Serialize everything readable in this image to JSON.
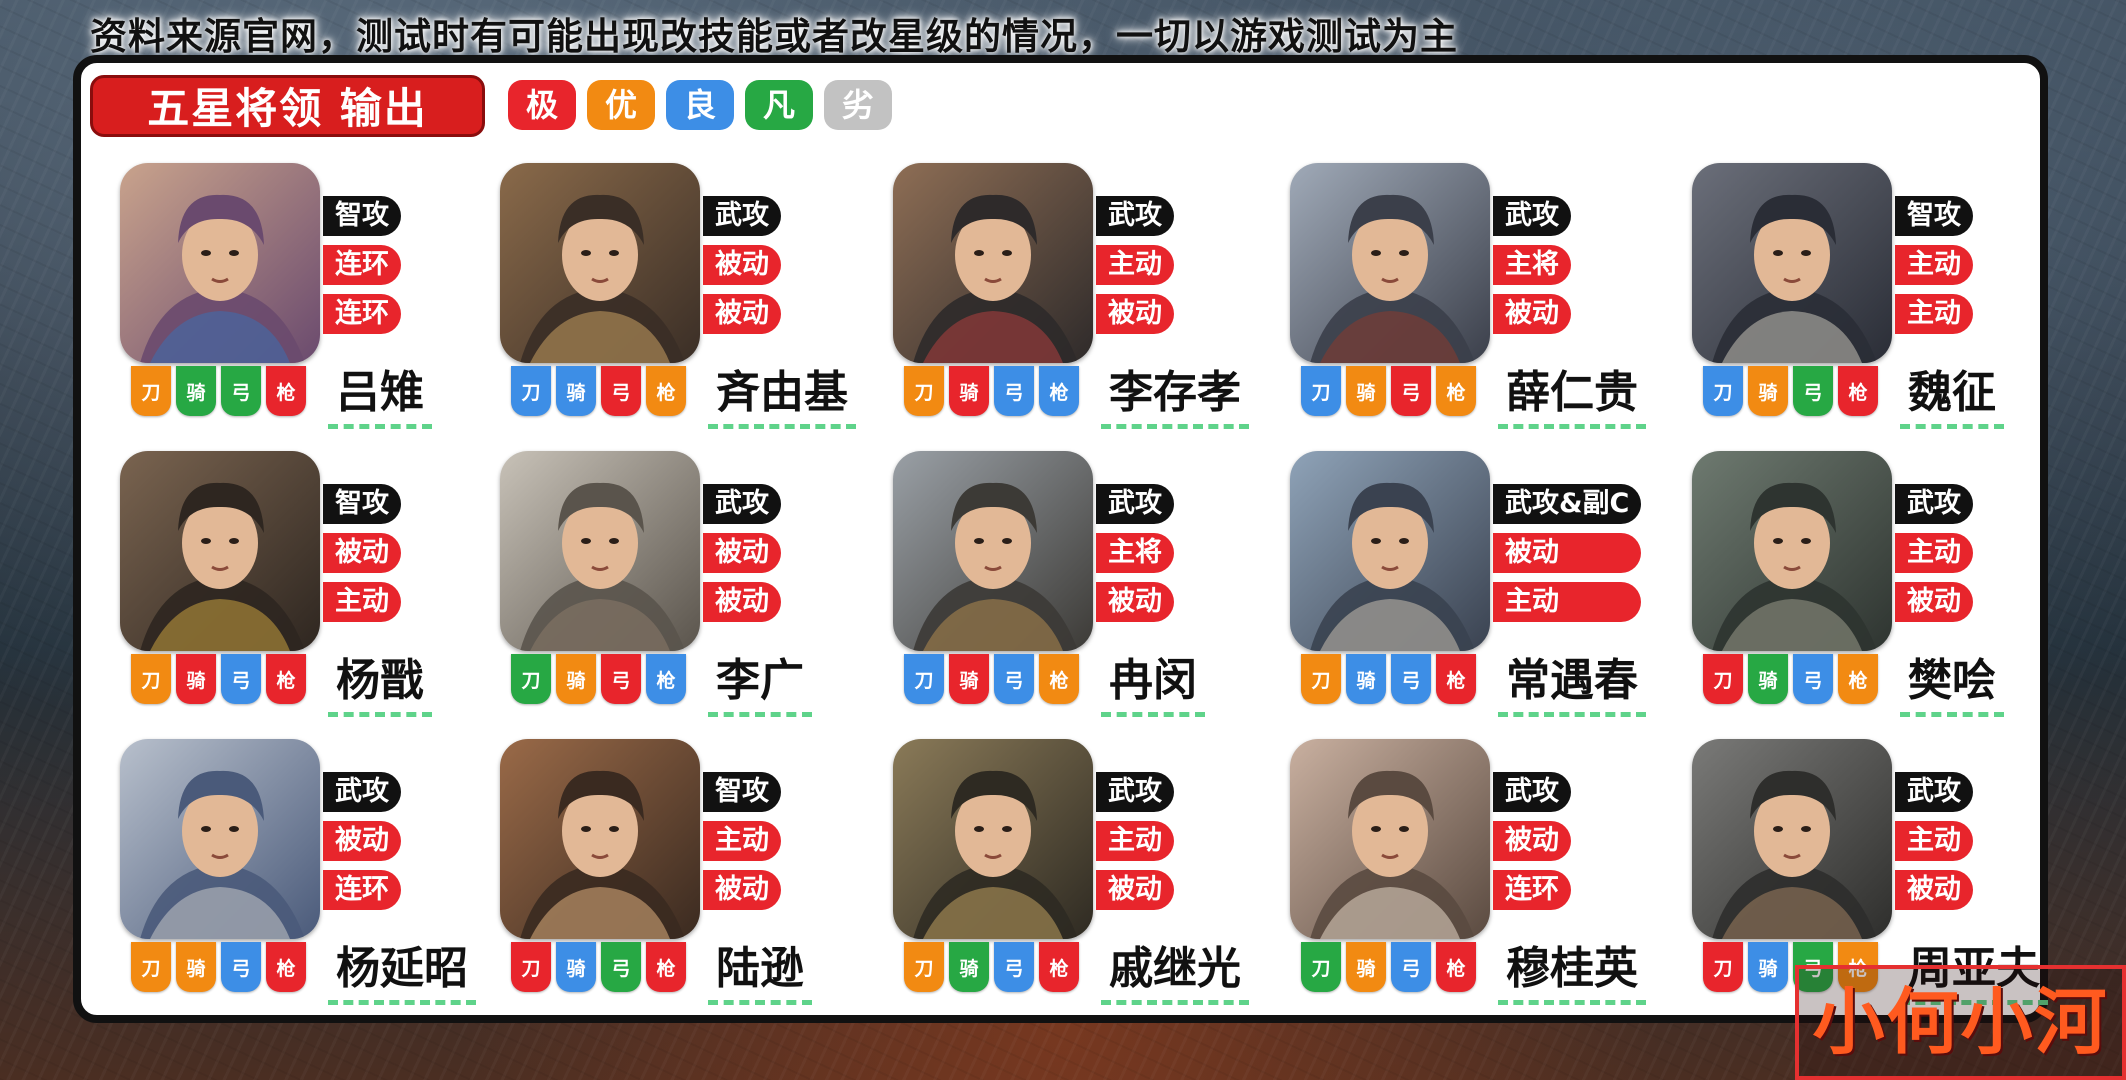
{
  "disclaimer": "资料来源官网，测试时有可能出现改技能或者改星级的情况，一切以游戏测试为主",
  "title": "五星将领  输出",
  "tiers": [
    {
      "label": "极",
      "color": "#e8252c"
    },
    {
      "label": "优",
      "color": "#f28a12"
    },
    {
      "label": "良",
      "color": "#3d8ee6"
    },
    {
      "label": "凡",
      "color": "#27a844"
    },
    {
      "label": "劣",
      "color": "#c2c2c2"
    }
  ],
  "weapon_labels": [
    "刀",
    "骑",
    "弓",
    "枪"
  ],
  "tier_colors": {
    "极": "#e8252c",
    "优": "#f28a12",
    "良": "#3d8ee6",
    "凡": "#27a844",
    "劣": "#c2c2c2"
  },
  "generals": [
    {
      "name": "吕雉",
      "type": "智攻",
      "skills": [
        "连环",
        "连环"
      ],
      "weapons": [
        "优",
        "凡",
        "凡",
        "极"
      ]
    },
    {
      "name": "斉由基",
      "type": "武攻",
      "skills": [
        "被动",
        "被动"
      ],
      "weapons": [
        "良",
        "良",
        "极",
        "优"
      ]
    },
    {
      "name": "李存孝",
      "type": "武攻",
      "skills": [
        "主动",
        "被动"
      ],
      "weapons": [
        "优",
        "极",
        "良",
        "良"
      ]
    },
    {
      "name": "薛仁贵",
      "type": "武攻",
      "skills": [
        "主将",
        "被动"
      ],
      "weapons": [
        "良",
        "优",
        "极",
        "优"
      ]
    },
    {
      "name": "魏征",
      "type": "智攻",
      "skills": [
        "主动",
        "主动"
      ],
      "weapons": [
        "良",
        "优",
        "凡",
        "极"
      ]
    },
    {
      "name": "杨戬",
      "type": "智攻",
      "skills": [
        "被动",
        "主动"
      ],
      "weapons": [
        "优",
        "极",
        "良",
        "极"
      ]
    },
    {
      "name": "李广",
      "type": "武攻",
      "skills": [
        "被动",
        "被动"
      ],
      "weapons": [
        "凡",
        "优",
        "极",
        "良"
      ]
    },
    {
      "name": "冉闵",
      "type": "武攻",
      "skills": [
        "主将",
        "被动"
      ],
      "weapons": [
        "良",
        "极",
        "良",
        "优"
      ]
    },
    {
      "name": "常遇春",
      "type": "武攻&副C",
      "skills": [
        "被动",
        "主动"
      ],
      "weapons": [
        "优",
        "良",
        "良",
        "极"
      ]
    },
    {
      "name": "樊哙",
      "type": "武攻",
      "skills": [
        "主动",
        "被动"
      ],
      "weapons": [
        "极",
        "凡",
        "良",
        "优"
      ]
    },
    {
      "name": "杨延昭",
      "type": "武攻",
      "skills": [
        "被动",
        "连环"
      ],
      "weapons": [
        "优",
        "优",
        "良",
        "极"
      ]
    },
    {
      "name": "陆逊",
      "type": "智攻",
      "skills": [
        "主动",
        "被动"
      ],
      "weapons": [
        "极",
        "良",
        "凡",
        "极"
      ]
    },
    {
      "name": "戚继光",
      "type": "武攻",
      "skills": [
        "主动",
        "被动"
      ],
      "weapons": [
        "优",
        "凡",
        "良",
        "极"
      ]
    },
    {
      "name": "穆桂英",
      "type": "武攻",
      "skills": [
        "被动",
        "连环"
      ],
      "weapons": [
        "凡",
        "优",
        "良",
        "极"
      ]
    },
    {
      "name": "周亚夫",
      "type": "武攻",
      "skills": [
        "主动",
        "被动"
      ],
      "weapons": [
        "极",
        "良",
        "凡",
        "优"
      ]
    }
  ],
  "watermark": "小何小河"
}
